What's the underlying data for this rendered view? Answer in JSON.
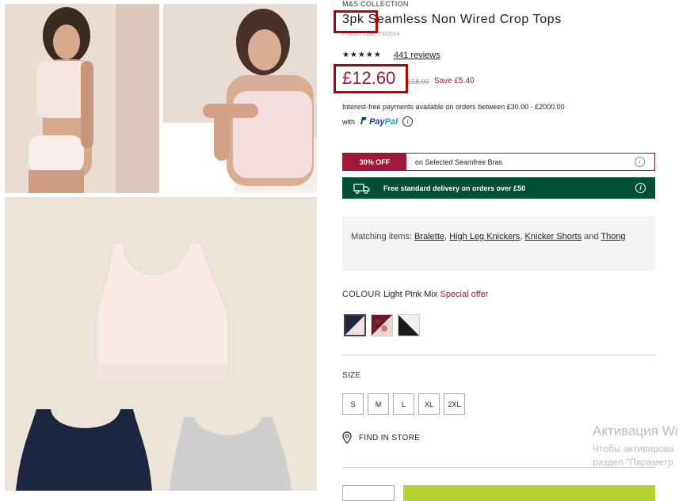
{
  "product": {
    "brand": "M&S COLLECTION",
    "title": "3pk Seamless Non Wired Crop Tops",
    "product_code": "Product code: T337014",
    "stars": "★★★★★",
    "reviews": "441 reviews",
    "price": "£12.60",
    "was_price": "£18.00",
    "save": "Save £5.40"
  },
  "payment": {
    "line1": "Interest-free payments available on orders between £30.00 - £2000.00",
    "with": "with",
    "paypal_a": "Pay",
    "paypal_b": "Pal"
  },
  "offer": {
    "tag": "30% OFF",
    "text": "on Selected Seamfree Bras"
  },
  "delivery": {
    "text": "Free standard delivery on orders over £50"
  },
  "matching": {
    "prefix": "Matching items:",
    "items": [
      "Bralette",
      "High Leg Knickers",
      "Knicker Shorts",
      "Thong"
    ],
    "sep1": ", ",
    "sep2": ", ",
    "and": " and "
  },
  "colour": {
    "label": "COLOUR",
    "value": "Light Pink Mix",
    "special": "Special offer",
    "swatches": [
      "navy-pink",
      "floral",
      "black-white"
    ]
  },
  "size": {
    "label": "SIZE",
    "options": [
      "S",
      "M",
      "L",
      "XL",
      "2XL"
    ]
  },
  "store": {
    "label": "FIND IN STORE"
  },
  "watermark": {
    "line1": "Активация Wi",
    "line2": "Чтобы активирова",
    "line3": "раздел \"Параметр"
  },
  "icons": {
    "pin": "map-pin-icon",
    "info": "info-icon",
    "truck": "truck-icon",
    "star": "star-icon"
  },
  "colors": {
    "accent": "#a1173a",
    "delivery_bg": "#005134",
    "add_bag": "#b5d233"
  }
}
